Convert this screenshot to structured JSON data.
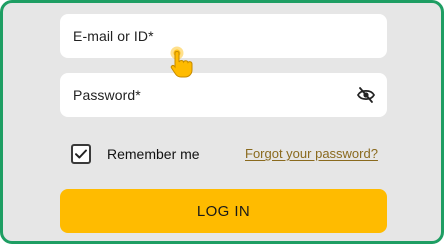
{
  "login_form": {
    "email_placeholder": "E-mail or ID*",
    "password_placeholder": "Password*",
    "remember_label": "Remember me",
    "remember_checked": true,
    "forgot_label": "Forgot your password?",
    "login_label": "LOG IN"
  },
  "icons": {
    "eye": "eye-slash-icon",
    "pointer": "tap-hand-icon",
    "check": "checkmark-icon"
  },
  "colors": {
    "frame_border": "#1e9e63",
    "background": "#e6e6e6",
    "button": "#ffbb00",
    "link": "#8a6a1e"
  }
}
